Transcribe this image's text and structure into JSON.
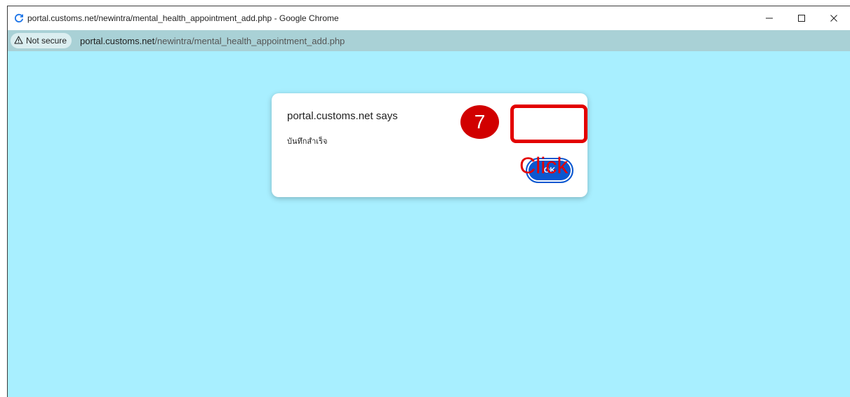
{
  "window": {
    "title": "portal.customs.net/newintra/mental_health_appointment_add.php - Google Chrome",
    "controls": {
      "minimize": "–",
      "maximize": "☐",
      "close": "✕"
    }
  },
  "addressbar": {
    "security_label": "Not secure",
    "url_host": "portal.customs.net",
    "url_path": "/newintra/mental_health_appointment_add.php"
  },
  "dialog": {
    "title": "portal.customs.net says",
    "message": "บันทึกสำเร็จ",
    "ok_label": "OK"
  },
  "annotation": {
    "step_number": "7",
    "action_label": "Click",
    "color": "#e30000"
  },
  "colors": {
    "page_background": "#a8efff",
    "addressbar_background": "#a9d1d6",
    "ok_button": "#0b57d0"
  },
  "icons": [
    "reload-icon",
    "warning-triangle-icon",
    "minimize-icon",
    "maximize-icon",
    "close-icon"
  ]
}
